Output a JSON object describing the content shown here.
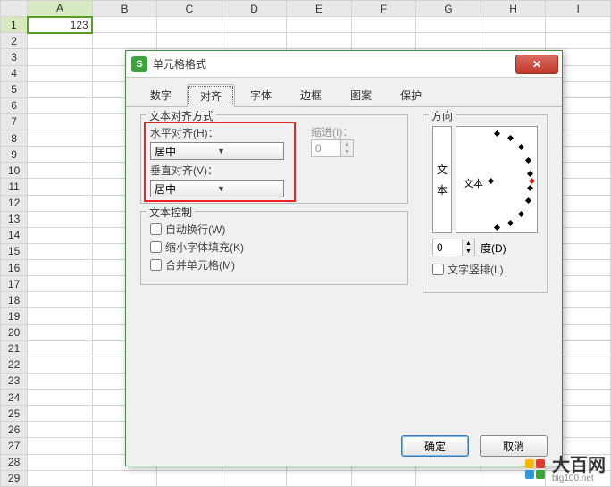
{
  "sheet": {
    "columns": [
      "A",
      "B",
      "C",
      "D",
      "E",
      "F",
      "G",
      "H",
      "I"
    ],
    "rows": [
      "1",
      "2",
      "3",
      "4",
      "5",
      "6",
      "7",
      "8",
      "9",
      "10",
      "11",
      "12",
      "13",
      "14",
      "15",
      "16",
      "17",
      "18",
      "19",
      "20",
      "21",
      "22",
      "23",
      "24",
      "25",
      "26",
      "27",
      "28",
      "29"
    ],
    "selected_cell_value": "123"
  },
  "dialog": {
    "title": "单元格格式",
    "tabs": [
      "数字",
      "对齐",
      "字体",
      "边框",
      "图案",
      "保护"
    ],
    "active_tab": "对齐",
    "align_group": "文本对齐方式",
    "h_label": "水平对齐(H)：",
    "h_value": "居中",
    "v_label": "垂直对齐(V)：",
    "v_value": "居中",
    "indent_label": "缩进(I)：",
    "indent_value": "0",
    "text_ctrl_group": "文本控制",
    "wrap": "自动换行(W)",
    "shrink": "缩小字体填充(K)",
    "merge": "合并单元格(M)",
    "orient_group": "方向",
    "orient_vtext": "文本",
    "orient_htext": "文本",
    "deg_value": "0",
    "deg_label": "度(D)",
    "vert_text": "文字竖排(L)",
    "ok": "确定",
    "cancel": "取消"
  },
  "watermark": {
    "name": "大百网",
    "url": "big100.net"
  }
}
